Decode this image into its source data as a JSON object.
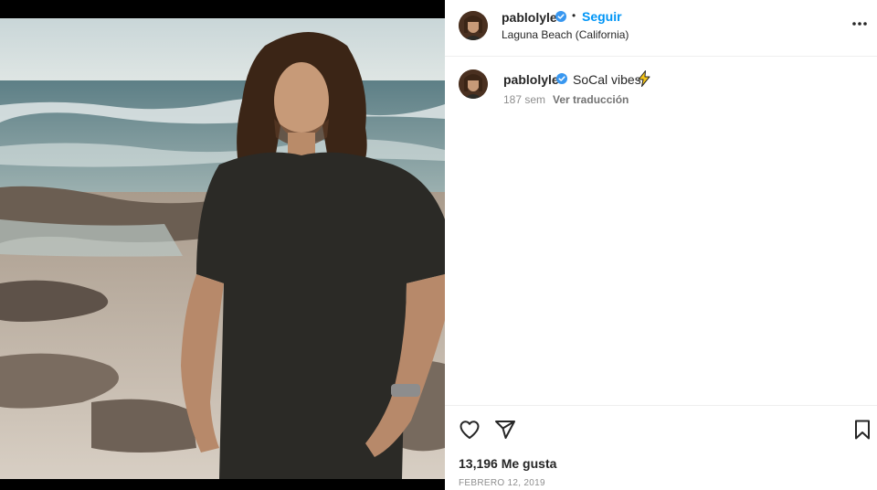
{
  "post": {
    "username": "pablolyle",
    "verified": true,
    "follow_label": "Seguir",
    "separator": "•",
    "location": "Laguna Beach (California)"
  },
  "caption": {
    "username": "pablolyle",
    "text": "SoCal vibes",
    "emoji_icon": "lightning-bolt-icon",
    "age": "187 sem",
    "translate_label": "Ver traducción"
  },
  "stats": {
    "likes": "13,196 Me gusta",
    "date": "FEBRERO 12, 2019"
  },
  "colors": {
    "accent": "#0095f6",
    "verified": "#3897f0",
    "text": "#262626",
    "muted": "#8e8e8e",
    "bolt": "#f5c518"
  }
}
